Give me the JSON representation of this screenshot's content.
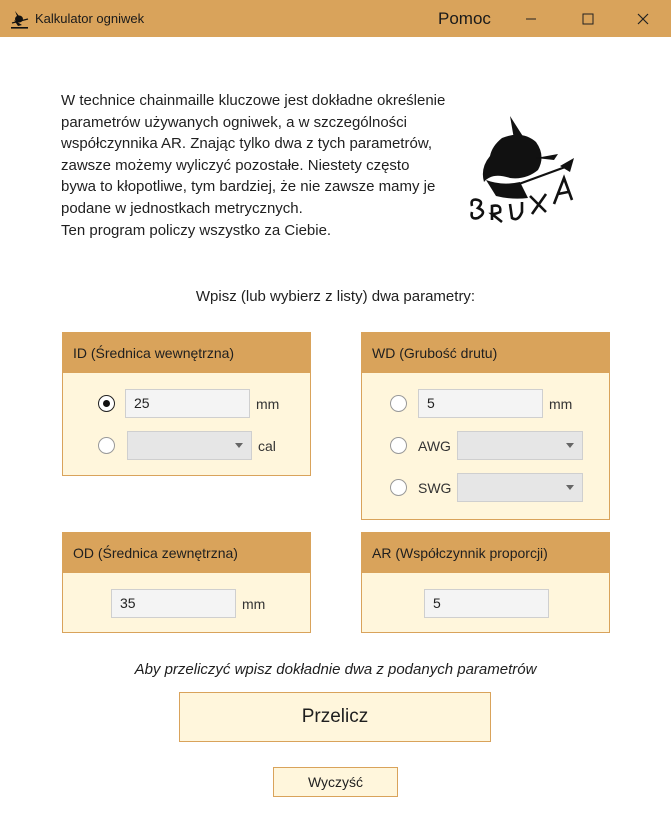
{
  "window": {
    "title": "Kalkulator ogniwek",
    "help_label": "Pomoc",
    "icons": {
      "app": "witch-icon",
      "minimize": "minimize-icon",
      "maximize": "maximize-icon",
      "close": "close-icon"
    }
  },
  "intro": {
    "paragraph": "W technice chainmaille kluczowe jest dokładne określenie parametrów używanych ogniwek, a w szczególności współczynnika AR. Znając tylko dwa z tych parametrów, zawsze możemy wyliczyć pozostałe. Niestety często bywa to kłopotliwe, tym bardziej, że nie zawsze mamy je podane w jednostkach metrycznych.",
    "line2": "Ten program policzy wszystko za Ciebie."
  },
  "logo": {
    "text": "BRUXA",
    "icon": "witch-on-broom-logo"
  },
  "instruction": "Wpisz (lub wybierz z listy) dwa parametry:",
  "id_panel": {
    "title": "ID (Średnica wewnętrzna)",
    "mm_value": "25",
    "mm_unit": "mm",
    "cal_value": "",
    "cal_unit": "cal",
    "selected": "mm"
  },
  "wd_panel": {
    "title": "WD (Grubość drutu)",
    "mm_value": "5",
    "mm_unit": "mm",
    "awg_label": "AWG",
    "awg_value": "",
    "swg_label": "SWG",
    "swg_value": "",
    "selected": "none"
  },
  "od_panel": {
    "title": "OD (Średnica zewnętrzna)",
    "value": "35",
    "unit": "mm"
  },
  "ar_panel": {
    "title": "AR (Współczynnik proporcji)",
    "value": "5"
  },
  "hint": "Aby przeliczyć wpisz dokładnie dwa z podanych parametrów",
  "buttons": {
    "calculate": "Przelicz",
    "clear": "Wyczyść"
  },
  "colors": {
    "accent": "#d9a35b",
    "panel_bg": "#fff6dc"
  }
}
